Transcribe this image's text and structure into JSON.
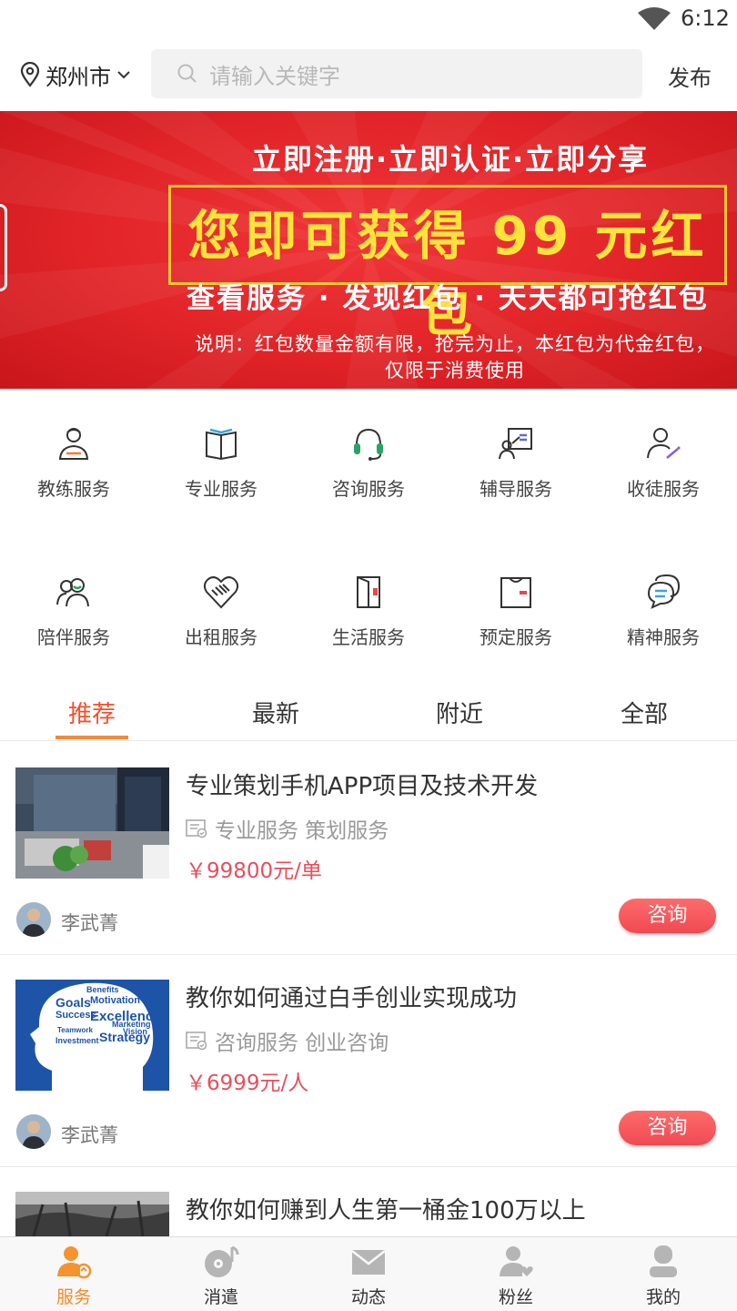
{
  "status_bar": {
    "time": "6:12"
  },
  "header": {
    "city": "郑州市",
    "search_placeholder": "请输入关键字",
    "publish_label": "发布"
  },
  "banner": {
    "line1": "立即注册·立即认证·立即分享",
    "headline": "您即可获得 99 元红包",
    "line3": "查看服务 · 发现红包 · 天天都可抢红包",
    "note": "说明：红包数量金额有限，抢完为止，本红包为代金红包，仅限于消费使用"
  },
  "categories": [
    {
      "label": "教练服务",
      "icon": "coach-icon"
    },
    {
      "label": "专业服务",
      "icon": "book-icon"
    },
    {
      "label": "咨询服务",
      "icon": "headset-icon"
    },
    {
      "label": "辅导服务",
      "icon": "tutor-board-icon"
    },
    {
      "label": "收徒服务",
      "icon": "apprentice-icon"
    },
    {
      "label": "陪伴服务",
      "icon": "companion-icon"
    },
    {
      "label": "出租服务",
      "icon": "handshake-icon"
    },
    {
      "label": "生活服务",
      "icon": "door-icon"
    },
    {
      "label": "预定服务",
      "icon": "reserve-shirt-icon"
    },
    {
      "label": "精神服务",
      "icon": "chat-bubble-icon"
    }
  ],
  "tabs": [
    "推荐",
    "最新",
    "附近",
    "全部"
  ],
  "active_tab": "推荐",
  "listings": [
    {
      "title": "专业策划手机APP项目及技术开发",
      "category": "专业服务 策划服务",
      "price": "￥99800元/单",
      "author": "李武菁",
      "action": "咨询"
    },
    {
      "title": "教你如何通过白手创业实现成功",
      "category": "咨询服务 创业咨询",
      "price": "￥6999元/人",
      "author": "李武菁",
      "action": "咨询"
    },
    {
      "title": "教你如何赚到人生第一桶金100万以上"
    }
  ],
  "thumb_words": [
    "Benefits",
    "Motivation",
    "Goals",
    "Success",
    "Excellence",
    "Teamwork",
    "Strategy",
    "Investment",
    "Marketing",
    "Vision"
  ],
  "bottom_nav": [
    {
      "label": "服务",
      "icon": "service-user-icon",
      "active": true
    },
    {
      "label": "消遣",
      "icon": "music-disc-icon",
      "active": false
    },
    {
      "label": "动态",
      "icon": "mail-icon",
      "active": false
    },
    {
      "label": "粉丝",
      "icon": "fans-heart-icon",
      "active": false
    },
    {
      "label": "我的",
      "icon": "profile-icon",
      "active": false
    }
  ],
  "colors": {
    "accent": "#f0502c",
    "price": "#e84e5c",
    "banner_red": "#e12428",
    "banner_yellow": "#ffe23b",
    "nav_active": "#f18a2c"
  }
}
